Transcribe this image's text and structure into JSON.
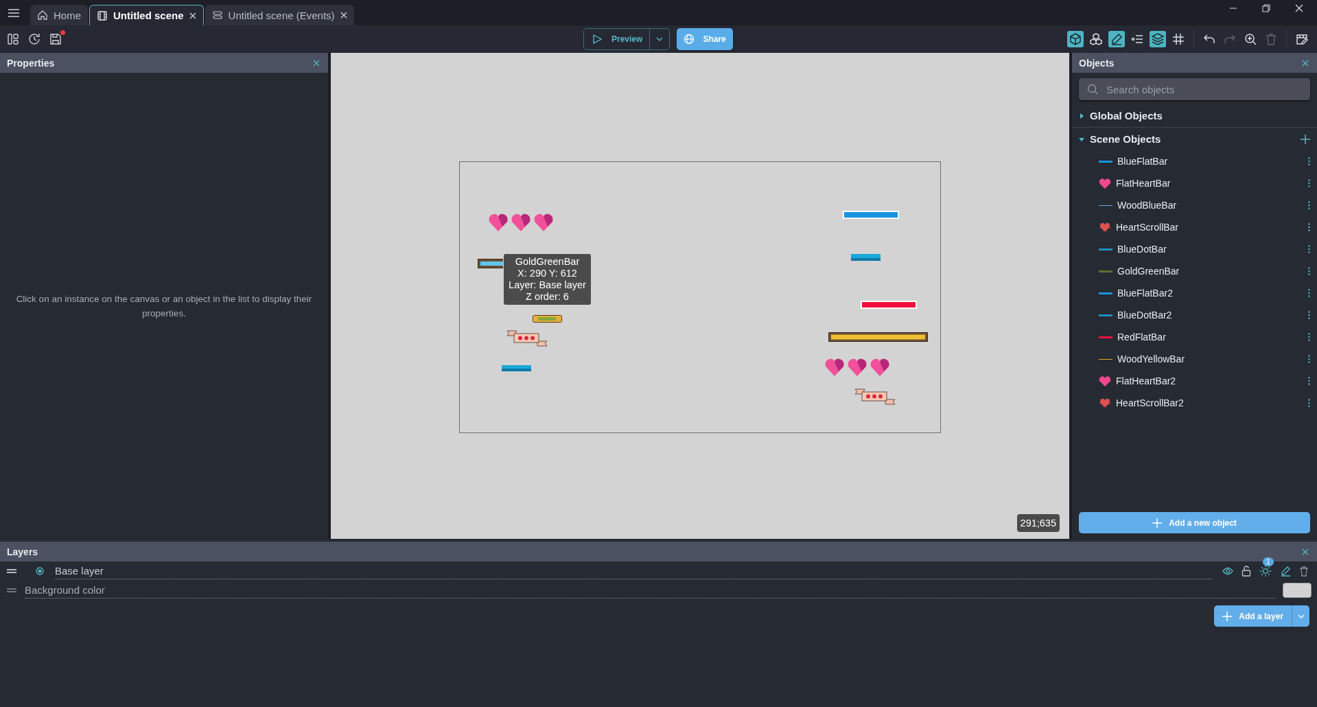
{
  "tabs": [
    {
      "label": "Home",
      "kind": "home",
      "selected": false,
      "closable": false
    },
    {
      "label": "Untitled scene",
      "kind": "scene",
      "selected": true,
      "closable": true
    },
    {
      "label": "Untitled scene (Events)",
      "kind": "events",
      "selected": false,
      "closable": true
    }
  ],
  "toolbar": {
    "unsaved": true,
    "preview": "Preview",
    "share": "Share",
    "tools": [
      {
        "kind": "cube",
        "on": true,
        "disabled": false
      },
      {
        "kind": "cubes",
        "on": false,
        "disabled": false
      },
      {
        "kind": "pencil",
        "on": true,
        "disabled": false
      },
      {
        "kind": "list",
        "on": false,
        "disabled": false
      },
      {
        "kind": "layers",
        "on": true,
        "disabled": false
      },
      {
        "kind": "grid",
        "on": false,
        "disabled": false
      },
      {
        "kind": "undo",
        "on": false,
        "disabled": false
      },
      {
        "kind": "redo",
        "on": false,
        "disabled": true
      },
      {
        "kind": "zoom",
        "on": false,
        "disabled": false
      },
      {
        "kind": "trash",
        "on": false,
        "disabled": true
      },
      {
        "kind": "scene-edit",
        "on": false,
        "disabled": false
      }
    ]
  },
  "properties": {
    "title": "Properties",
    "message": "Click on an instance on the canvas or an object in the list to display their properties."
  },
  "canvas": {
    "tooltip": [
      "GoldGreenBar",
      "X: 290  Y: 612",
      "Layer: Base layer",
      "Z order: 6"
    ],
    "cursor": "291;635"
  },
  "objects": {
    "title": "Objects",
    "search": {
      "placeholder": "Search objects"
    },
    "groups": [
      {
        "label": "Global Objects",
        "expanded": false
      },
      {
        "label": "Scene Objects",
        "expanded": true,
        "items": [
          {
            "name": "BlueFlatBar",
            "kind": "line",
            "color": "#1594e0"
          },
          {
            "name": "FlatHeartBar",
            "kind": "heart",
            "color": "#f0488f"
          },
          {
            "name": "WoodBlueBar",
            "kind": "thin-line",
            "color": "#58b3e0"
          },
          {
            "name": "HeartScrollBar",
            "kind": "heart-scroll",
            "color": "#e05050"
          },
          {
            "name": "BlueDotBar",
            "kind": "line",
            "color": "#1a8fbf"
          },
          {
            "name": "GoldGreenBar",
            "kind": "line",
            "color": "#5a7030"
          },
          {
            "name": "BlueFlatBar2",
            "kind": "line",
            "color": "#1594e0"
          },
          {
            "name": "BlueDotBar2",
            "kind": "line",
            "color": "#1a8fbf"
          },
          {
            "name": "RedFlatBar",
            "kind": "line",
            "color": "#f0103f"
          },
          {
            "name": "WoodYellowBar",
            "kind": "thin-line",
            "color": "#e0b020"
          },
          {
            "name": "FlatHeartBar2",
            "kind": "heart",
            "color": "#f0488f"
          },
          {
            "name": "HeartScrollBar2",
            "kind": "heart-scroll",
            "color": "#e05050"
          }
        ]
      }
    ],
    "add_button": "Add a new object"
  },
  "layers": {
    "title": "Layers",
    "rows": [
      {
        "label": "Base layer",
        "kind": "layer",
        "selected": true,
        "effects_count": "1"
      },
      {
        "label": "Background color",
        "kind": "background"
      }
    ],
    "add_button": "Add a layer"
  }
}
